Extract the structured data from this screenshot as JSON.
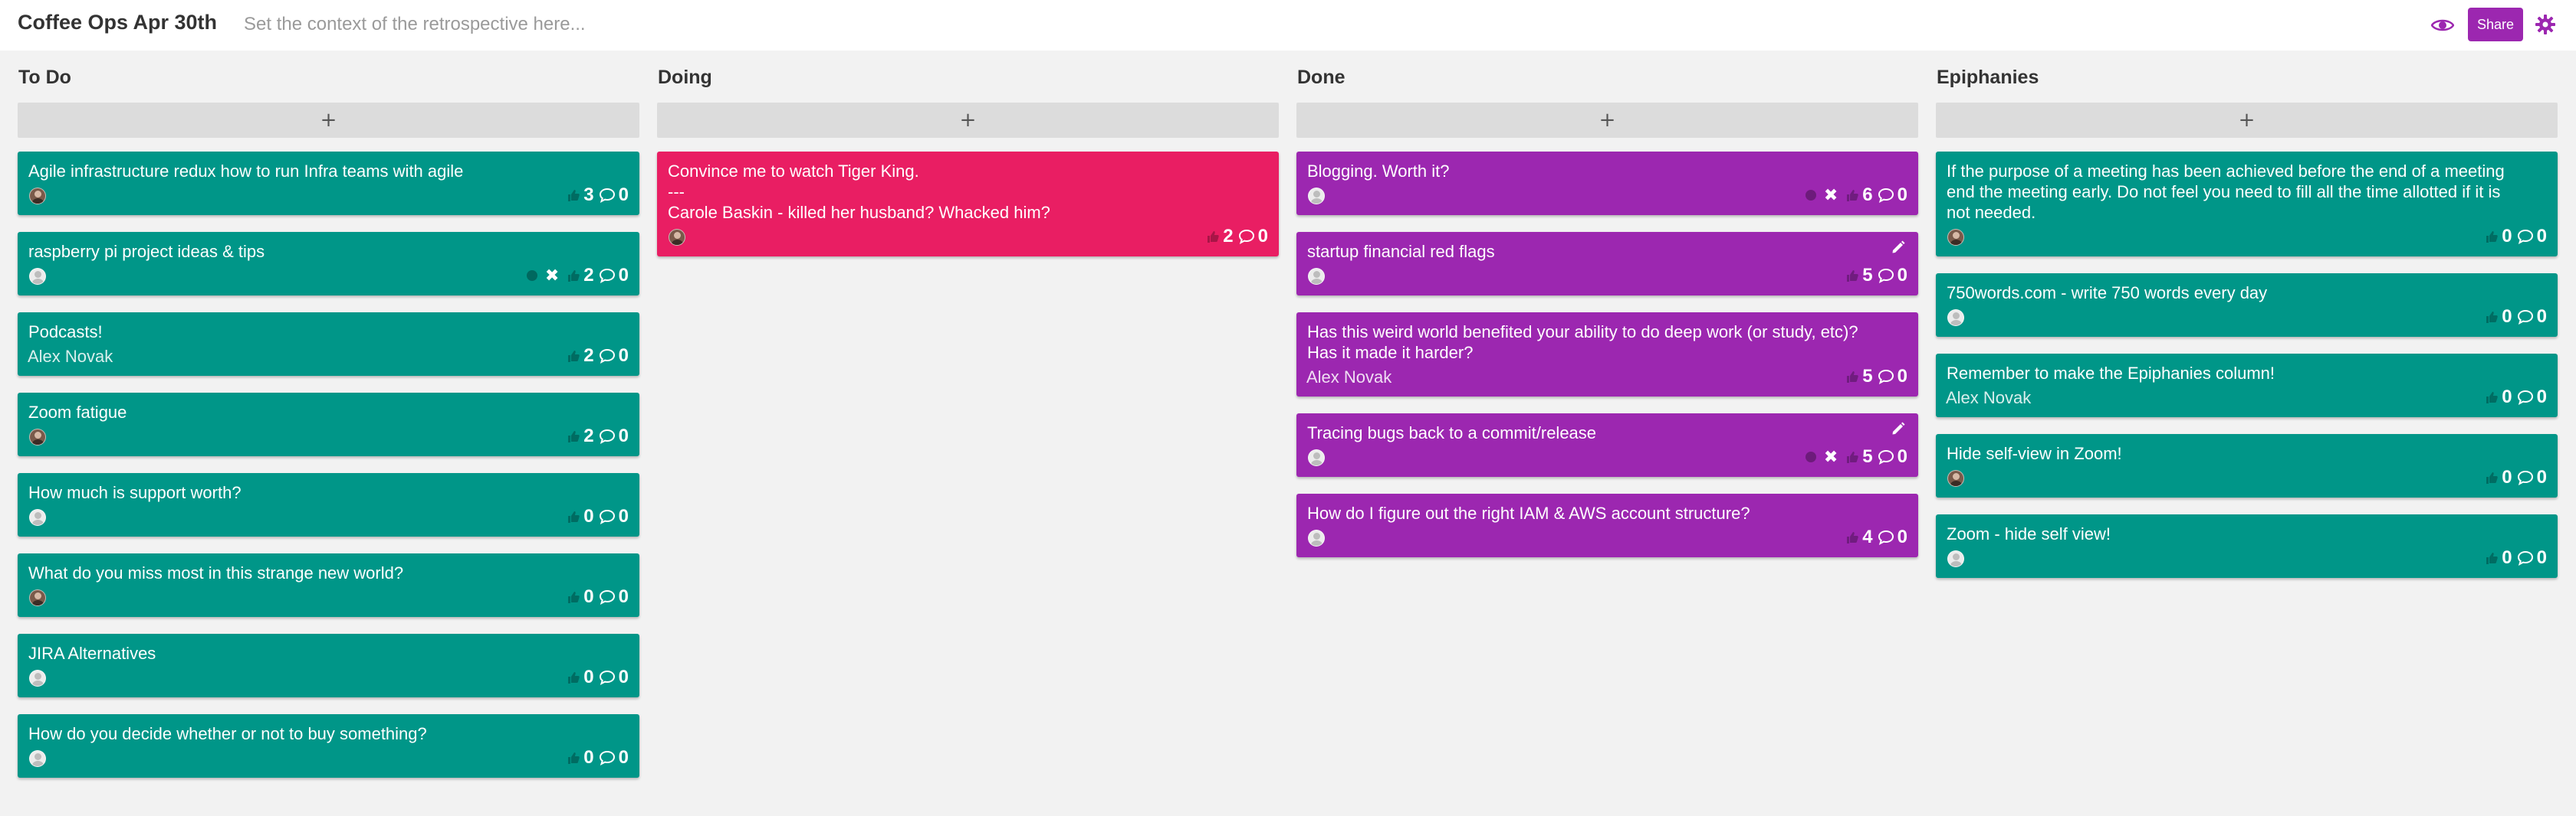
{
  "header": {
    "title": "Coffee Ops Apr 30th",
    "context_placeholder": "Set the context of the retrospective here...",
    "share_label": "Share",
    "accent_color": "#9c27b0"
  },
  "columns": [
    {
      "title": "To Do",
      "add_label": "+",
      "cards": [
        {
          "text": "Agile infrastructure redux how to run Infra teams with agile",
          "avatar": "dark",
          "votes": "3",
          "comments": "0",
          "color": "teal"
        },
        {
          "text": "raspberry pi project ideas & tips",
          "avatar": "light",
          "votes": "2",
          "comments": "0",
          "color": "teal",
          "my_vote": true
        },
        {
          "text": "Podcasts!",
          "author": "Alex Novak",
          "votes": "2",
          "comments": "0",
          "color": "teal"
        },
        {
          "text": "Zoom fatigue",
          "avatar": "dark",
          "votes": "2",
          "comments": "0",
          "color": "teal"
        },
        {
          "text": "How much is support worth?",
          "avatar": "light",
          "votes": "0",
          "comments": "0",
          "color": "teal"
        },
        {
          "text": "What do you miss most in this strange new world?",
          "avatar": "dark",
          "votes": "0",
          "comments": "0",
          "color": "teal"
        },
        {
          "text": "JIRA Alternatives",
          "avatar": "light",
          "votes": "0",
          "comments": "0",
          "color": "teal"
        },
        {
          "text": "How do you decide whether or not to buy something?",
          "avatar": "light",
          "votes": "0",
          "comments": "0",
          "color": "teal"
        }
      ]
    },
    {
      "title": "Doing",
      "add_label": "+",
      "cards": [
        {
          "text": "Convince me to watch Tiger King.\n---\nCarole Baskin - killed her husband? Whacked him?",
          "avatar": "dark",
          "votes": "2",
          "comments": "0",
          "color": "pink"
        }
      ]
    },
    {
      "title": "Done",
      "add_label": "+",
      "cards": [
        {
          "text": "Blogging. Worth it?",
          "avatar": "light",
          "votes": "6",
          "comments": "0",
          "color": "purple",
          "my_vote": true
        },
        {
          "text": "startup financial red flags",
          "avatar": "light",
          "votes": "5",
          "comments": "0",
          "color": "purple",
          "editable": true
        },
        {
          "text": "Has this weird world benefited your ability to do deep work (or study, etc)? Has it made it harder?",
          "author": "Alex Novak",
          "votes": "5",
          "comments": "0",
          "color": "purple"
        },
        {
          "text": "Tracing bugs back to a commit/release",
          "avatar": "light",
          "votes": "5",
          "comments": "0",
          "color": "purple",
          "editable": true,
          "my_vote": true
        },
        {
          "text": "How do I figure out the right IAM & AWS account structure?",
          "avatar": "light",
          "votes": "4",
          "comments": "0",
          "color": "purple"
        }
      ]
    },
    {
      "title": "Epiphanies",
      "add_label": "+",
      "cards": [
        {
          "text": "If the purpose of a meeting has been achieved before the end of a meeting end the meeting early. Do not feel you need to fill all the time allotted if it is not needed.",
          "avatar": "dark",
          "votes": "0",
          "comments": "0",
          "color": "teal"
        },
        {
          "text": "750words.com - write 750 words every day",
          "avatar": "light",
          "votes": "0",
          "comments": "0",
          "color": "teal"
        },
        {
          "text": "Remember to make the Epiphanies column!",
          "author": "Alex Novak",
          "votes": "0",
          "comments": "0",
          "color": "teal"
        },
        {
          "text": "Hide self-view in Zoom!",
          "avatar": "dark",
          "votes": "0",
          "comments": "0",
          "color": "teal"
        },
        {
          "text": "Zoom - hide self view!",
          "avatar": "light",
          "votes": "0",
          "comments": "0",
          "color": "teal"
        }
      ]
    }
  ]
}
